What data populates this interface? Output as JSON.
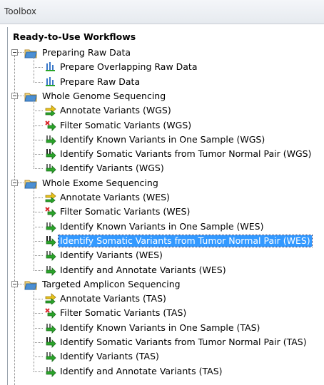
{
  "window": {
    "title": "Toolbox"
  },
  "tree": {
    "root_label": "Ready-to-Use Workflows",
    "folders": [
      {
        "label": "Preparing Raw Data",
        "items": [
          "Prepare Overlapping Raw Data",
          "Prepare Raw Data"
        ]
      },
      {
        "label": "Whole Genome Sequencing",
        "items": [
          "Annotate Variants (WGS)",
          "Filter Somatic Variants (WGS)",
          "Identify Known Variants in One Sample (WGS)",
          "Identify Somatic Variants from Tumor Normal Pair (WGS)",
          "Identify Variants (WGS)"
        ]
      },
      {
        "label": "Whole Exome Sequencing",
        "items": [
          "Annotate Variants (WES)",
          "Filter Somatic Variants (WES)",
          "Identify Known Variants in One Sample (WES)",
          "Identify Somatic Variants from Tumor Normal Pair (WES)",
          "Identify Variants (WES)",
          "Identify and Annotate Variants (WES)"
        ]
      },
      {
        "label": "Targeted Amplicon Sequencing",
        "items": [
          "Annotate Variants (TAS)",
          "Filter Somatic Variants (TAS)",
          "Identify Known Variants in One Sample (TAS)",
          "Identify Somatic Variants from Tumor Normal Pair (TAS)",
          "Identify Variants (TAS)",
          "Identify and Annotate Variants (TAS)"
        ]
      }
    ],
    "selected_item": "Identify Somatic Variants from Tumor Normal Pair (WES)"
  },
  "colors": {
    "selection": "#3399ff",
    "selection_text": "#ffffff",
    "folder": "#4a8fd4",
    "arrow_green": "#2aa52a",
    "arrow_yellow": "#e8c21a",
    "x_red": "#d9262a"
  }
}
